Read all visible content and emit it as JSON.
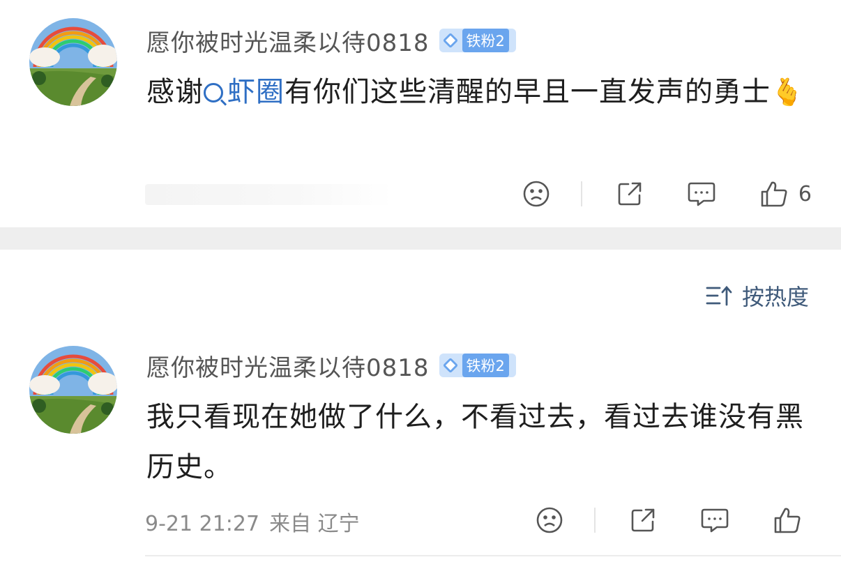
{
  "comments": [
    {
      "username": "愿你被时光温柔以待0818",
      "badge": "铁粉2",
      "text_before": "感谢",
      "topic": "虾圈",
      "text_after": "有你们这些清醒的早且一直发声的勇士",
      "emoji": "🫰",
      "like_count": "6"
    },
    {
      "username": "愿你被时光温柔以待0818",
      "badge": "铁粉2",
      "text": "我只看现在她做了什么，不看过去，看过去谁没有黑历史。",
      "time": "9-21 21:27",
      "source": "来自 辽宁",
      "like_count": ""
    }
  ],
  "sort": {
    "label": "按热度"
  },
  "icons": {
    "dislike": "sad-face-icon",
    "share": "share-icon",
    "comment": "comment-bubble-icon",
    "like": "thumbs-up-icon",
    "sort": "sort-icon"
  },
  "colors": {
    "badge": "#6aa5ee",
    "topic_link": "#2f6fc4",
    "divider": "#eeeeee"
  }
}
